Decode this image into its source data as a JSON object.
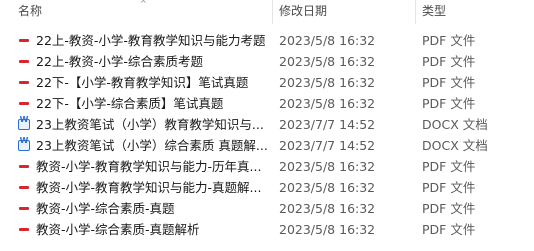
{
  "columns": {
    "name": "名称",
    "date": "修改日期",
    "type": "类型"
  },
  "files": [
    {
      "name": "22上-教资-小学-教育教学知识与能力考题",
      "date": "2023/5/8 16:32",
      "type": "PDF 文件",
      "icon": "pdf-icon"
    },
    {
      "name": "22上-教资-小学-综合素质考题",
      "date": "2023/5/8 16:32",
      "type": "PDF 文件",
      "icon": "pdf-icon"
    },
    {
      "name": "22下-【小学-教育教学知识】笔试真题",
      "date": "2023/5/8 16:32",
      "type": "PDF 文件",
      "icon": "pdf-icon"
    },
    {
      "name": "22下-【小学-综合素质】笔试真题",
      "date": "2023/5/8 16:32",
      "type": "PDF 文件",
      "icon": "pdf-icon"
    },
    {
      "name": "23上教资笔试（小学）教育教学知识与...",
      "date": "2023/7/7 14:52",
      "type": "DOCX 文档",
      "icon": "docx-icon"
    },
    {
      "name": "23上教资笔试（小学）综合素质 真题解...",
      "date": "2023/7/7 14:52",
      "type": "DOCX 文档",
      "icon": "docx-icon"
    },
    {
      "name": "教资-小学-教育教学知识与能力-历年真...",
      "date": "2023/5/8 16:32",
      "type": "PDF 文件",
      "icon": "pdf-icon"
    },
    {
      "name": "教资-小学-教育教学知识与能力-真题解...",
      "date": "2023/5/8 16:32",
      "type": "PDF 文件",
      "icon": "pdf-icon"
    },
    {
      "name": "教资-小学-综合素质-真题",
      "date": "2023/5/8 16:32",
      "type": "PDF 文件",
      "icon": "pdf-icon"
    },
    {
      "name": "教资-小学-综合素质-真题解析",
      "date": "2023/5/8 16:32",
      "type": "PDF 文件",
      "icon": "pdf-icon"
    }
  ],
  "colors": {
    "pdf": "#d8262f",
    "docx": "#2b6fd6"
  }
}
